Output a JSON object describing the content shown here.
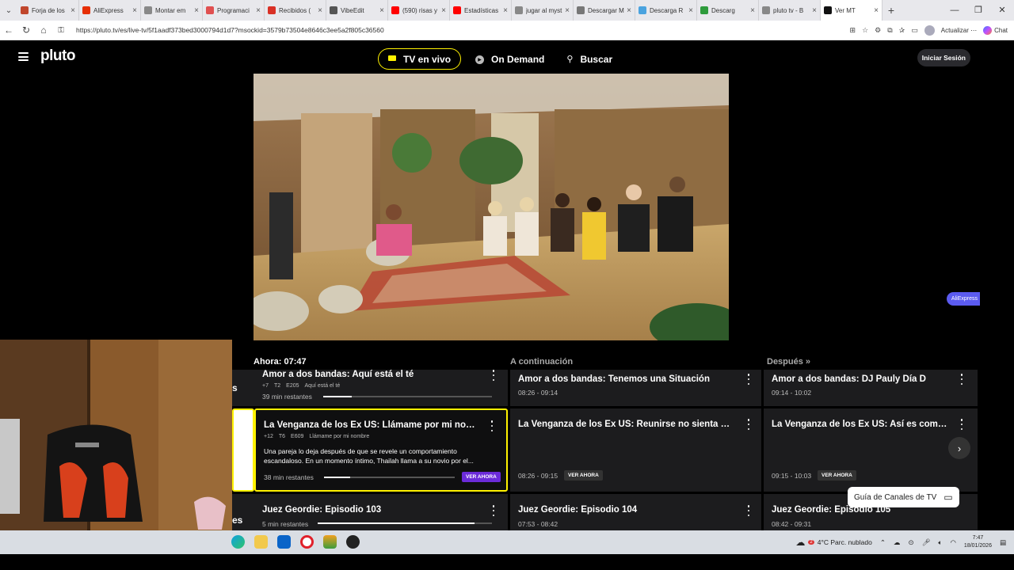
{
  "browser": {
    "tabs": [
      {
        "title": "Forja de los",
        "color": "#c0462c"
      },
      {
        "title": "AliExpress",
        "color": "#e62e04"
      },
      {
        "title": "Montar em",
        "color": "#888888"
      },
      {
        "title": "Programaci",
        "color": "#e05050"
      },
      {
        "title": "Recibidos (",
        "color": "#d93025"
      },
      {
        "title": "VibeEdit",
        "color": "#555555"
      },
      {
        "title": "(590) risas y",
        "color": "#ff0000"
      },
      {
        "title": "Estadísticas",
        "color": "#ff0000"
      },
      {
        "title": "jugar al myst",
        "color": "#888888"
      },
      {
        "title": "Descargar M",
        "color": "#777777"
      },
      {
        "title": "Descarga R",
        "color": "#4aa3df"
      },
      {
        "title": "Descarg",
        "color": "#2e9b3c"
      },
      {
        "title": "pluto tv - B",
        "color": "#888888"
      },
      {
        "title": "Ver MT",
        "color": "#111111"
      }
    ],
    "url": "https://pluto.tv/es/live-tv/5f1aadf373bed3000794d1d7?msockid=3579b73504e8646c3ee5a2f805c36560",
    "update_label": "Actualizar",
    "chat_label": "Chat"
  },
  "nav": {
    "logo": "pluto",
    "links": [
      {
        "label": "TV en vivo"
      },
      {
        "label": "On Demand"
      },
      {
        "label": "Buscar"
      }
    ],
    "login": "Iniciar Sesión"
  },
  "aliexpress_badge": "AliExpress",
  "guide": {
    "now_label": "Ahora: 07:47",
    "next_label": "A continuación",
    "after_label": "Después",
    "rows": [
      {
        "now": {
          "title": "Amor a dos bandas: Aquí está el té",
          "rating": "+7",
          "season": "T2",
          "episode": "E205",
          "ep_title": "Aquí está el té",
          "remaining": "39 min restantes",
          "progress": 0.17
        },
        "next": {
          "title": "Amor a dos bandas: Tenemos una Situación",
          "time": "08:26 - 09:14"
        },
        "after": {
          "title": "Amor a dos bandas: DJ Pauly Día D",
          "time": "09:14 - 10:02"
        }
      },
      {
        "now": {
          "title": "La Venganza de los Ex US: Llámame por mi nombre",
          "rating": "+12",
          "season": "T6",
          "episode": "E609",
          "ep_title": "Llámame por mi nombre",
          "description": "Una pareja lo deja después de que se revele un comportamiento escandaloso. En un momento íntimo, Thailah llama a su novio por el...",
          "remaining": "38 min restantes",
          "progress": 0.2,
          "cta": "VER AHORA"
        },
        "next": {
          "title": "La Venganza de los Ex US: Reunirse no sienta bien",
          "time": "08:26 - 09:15",
          "cta": "VER AHORA"
        },
        "after": {
          "title": "La Venganza de los Ex US: Así es como te...",
          "time": "09:15 - 10:03",
          "cta": "VER AHORA"
        }
      },
      {
        "now": {
          "title": "Juez Geordie: Episodio 103",
          "remaining": "5 min restantes",
          "progress": 0.9
        },
        "next": {
          "title": "Juez Geordie: Episodio 104",
          "time": "07:53 - 08:42"
        },
        "after": {
          "title": "Juez Geordie: Episodio 105",
          "time": "08:42 - 09:31"
        }
      }
    ],
    "channel_guide_button": "Guía de Canales de TV"
  },
  "taskbar": {
    "weather": "4°C  Parc. nublado",
    "weather_badge": "2",
    "time": "7:47",
    "date": "18/01/2026"
  }
}
